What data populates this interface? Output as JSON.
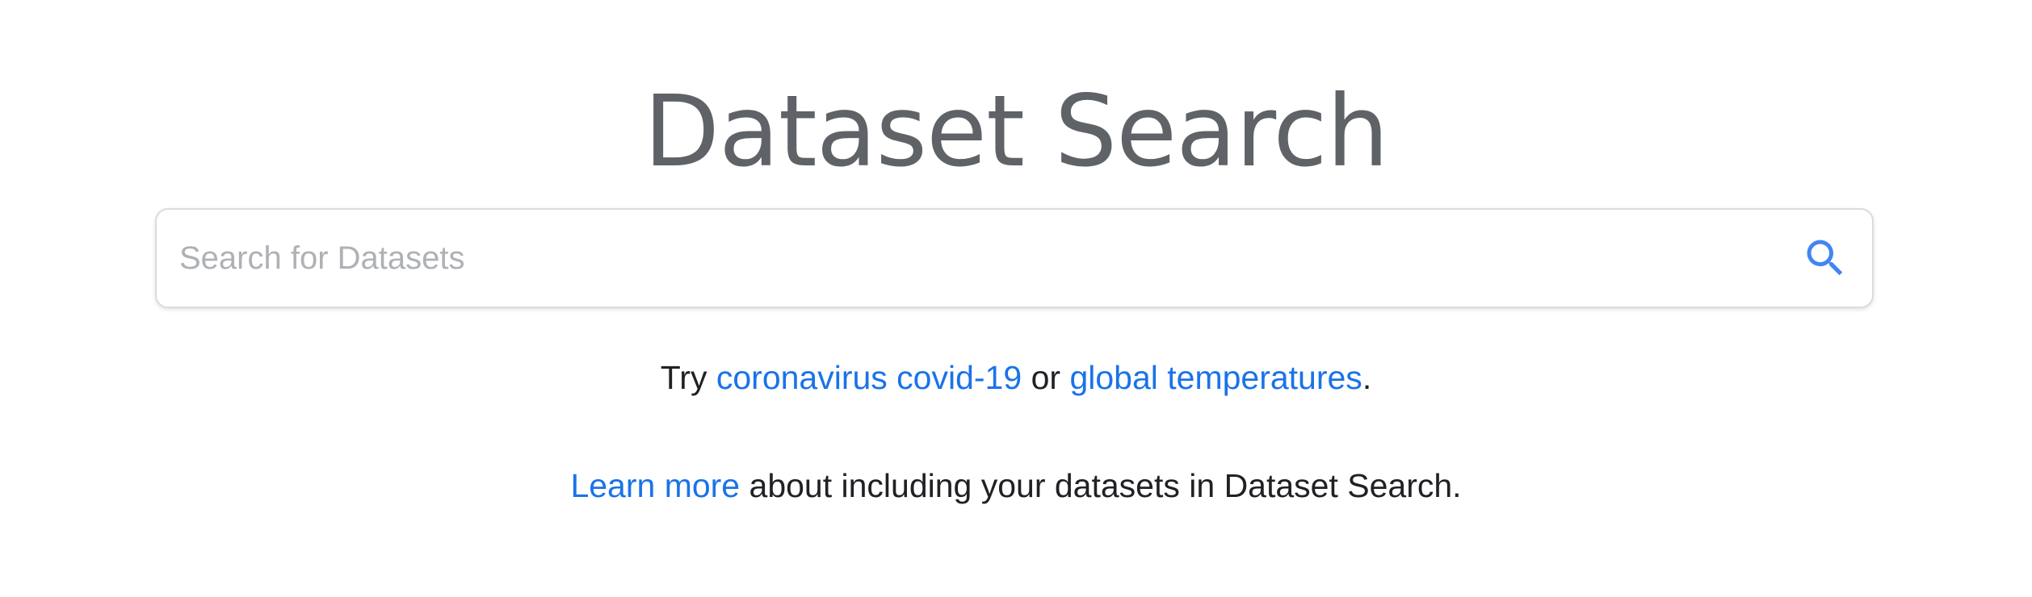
{
  "header": {
    "title": "Dataset Search"
  },
  "search": {
    "placeholder": "Search for Datasets",
    "value": "",
    "icon": "search-icon"
  },
  "suggestions": {
    "prefix": "Try",
    "items": [
      {
        "label": "coronavirus covid-19"
      },
      {
        "label": "global temperatures"
      }
    ],
    "separator": "or",
    "suffix": "."
  },
  "learn_more": {
    "link_label": "Learn more",
    "text": "about including your datasets in Dataset Search."
  },
  "colors": {
    "title": "#5f6368",
    "link": "#1a73e8",
    "icon": "#4285f4",
    "text": "#202124",
    "border": "#dadce0"
  }
}
